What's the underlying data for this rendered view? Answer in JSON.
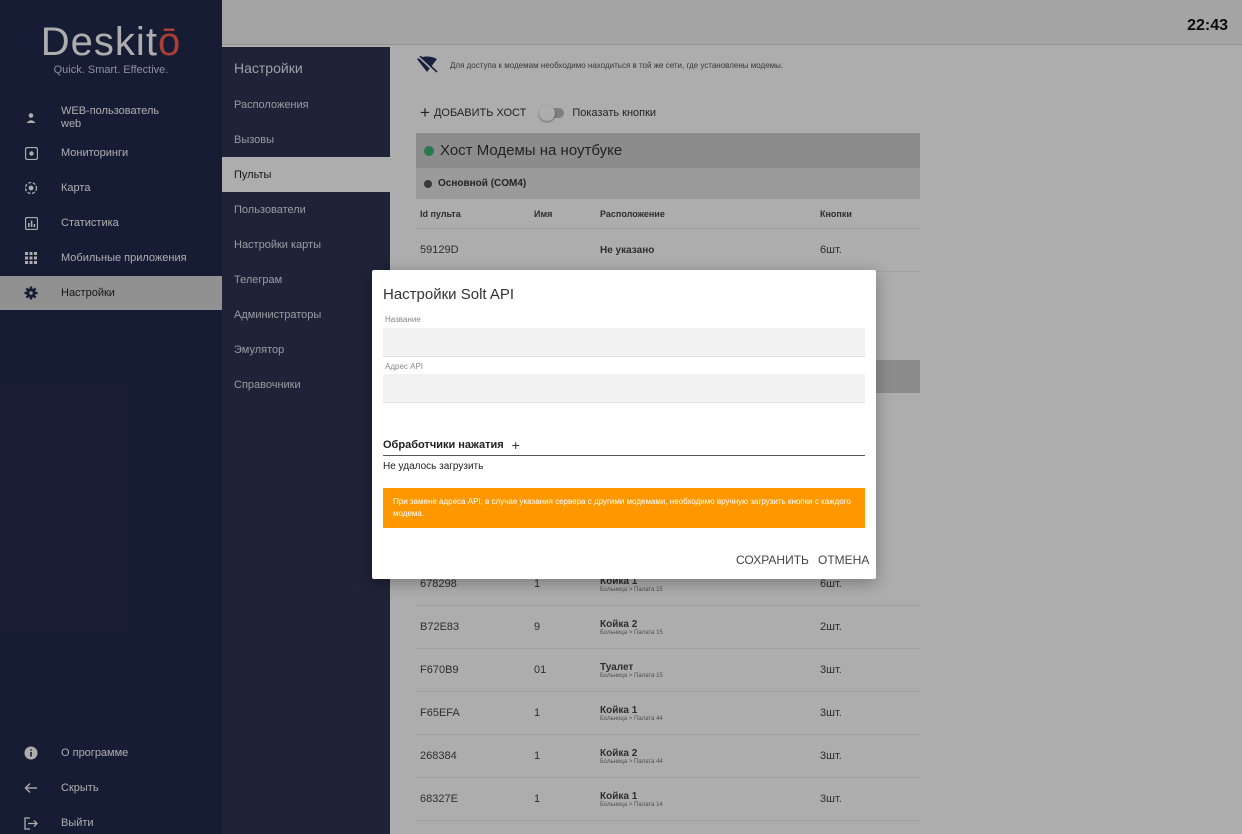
{
  "clock": "22:43",
  "brand": {
    "name_main": "Deskit",
    "name_accent": "ō",
    "tagline": "Quick. Smart. Effective."
  },
  "sidebar": {
    "user": {
      "label": "WEB-пользователь",
      "login": "web"
    },
    "items": [
      {
        "label": "Мониторинги",
        "icon": "eye-icon"
      },
      {
        "label": "Карта",
        "icon": "map-pin-icon"
      },
      {
        "label": "Статистика",
        "icon": "chart-icon"
      },
      {
        "label": "Мобильные приложения",
        "icon": "apps-grid-icon"
      },
      {
        "label": "Настройки",
        "icon": "gear-icon",
        "active": true
      }
    ],
    "bottom": [
      {
        "label": "О программе",
        "icon": "info-icon"
      },
      {
        "label": "Скрыть",
        "icon": "arrow-left-icon"
      },
      {
        "label": "Выйти",
        "icon": "logout-icon"
      }
    ]
  },
  "subnav": {
    "title": "Настройки",
    "items": [
      {
        "label": "Расположения"
      },
      {
        "label": "Вызовы"
      },
      {
        "label": "Пульты",
        "active": true
      },
      {
        "label": "Пользователи"
      },
      {
        "label": "Настройки карты"
      },
      {
        "label": "Телеграм"
      },
      {
        "label": "Администраторы"
      },
      {
        "label": "Эмулятор"
      },
      {
        "label": "Справочники"
      }
    ]
  },
  "main": {
    "notice": "Для доступа к модемам необходимо находиться в той же сети, где установлены модемы.",
    "add_host": "ДОБАВИТЬ ХОСТ",
    "show_buttons": "Показать кнопки",
    "host_title": "Хост Модемы на ноутбуке",
    "host_status_color": "#3cb371",
    "modem_title": "Основной (COM4)",
    "modem_status_color": "#555555",
    "columns": {
      "id": "Id пульта",
      "name": "Имя",
      "location": "Расположение",
      "buttons": "Кнопки"
    },
    "first_row": {
      "id": "59129D",
      "name": "",
      "location": "Не указано",
      "buttons": "6шт."
    },
    "rows": [
      {
        "id": "678298",
        "name": "1",
        "loc_name": "Койка 1",
        "loc_path": "Больница > Палата 15",
        "buttons": "6шт."
      },
      {
        "id": "B72E83",
        "name": "9",
        "loc_name": "Койка 2",
        "loc_path": "Больница > Палата 15",
        "buttons": "2шт."
      },
      {
        "id": "F670B9",
        "name": "01",
        "loc_name": "Туалет",
        "loc_path": "Больница > Палата 15",
        "buttons": "3шт."
      },
      {
        "id": "F65EFA",
        "name": "1",
        "loc_name": "Койка 1",
        "loc_path": "Больница > Палата 44",
        "buttons": "3шт."
      },
      {
        "id": "268384",
        "name": "1",
        "loc_name": "Койка 2",
        "loc_path": "Больница > Палата 44",
        "buttons": "3шт."
      },
      {
        "id": "68327E",
        "name": "1",
        "loc_name": "Койка 1",
        "loc_path": "Больница > Палата 14",
        "buttons": "3шт."
      }
    ]
  },
  "modal": {
    "title": "Настройки Solt API",
    "name_label": "Название",
    "name_value": "",
    "api_label": "Адрес API",
    "api_value": "",
    "handlers_label": "Обработчики нажатия",
    "load_error": "Не удалось загрузить",
    "warning": "При замене адреса API, в случае указания сервера с другими модемами, необходимо вручную загрузить кнопки с каждого модема.",
    "warning_color": "#ff9800",
    "save": "СОХРАНИТЬ",
    "cancel": "ОТМЕНА"
  }
}
